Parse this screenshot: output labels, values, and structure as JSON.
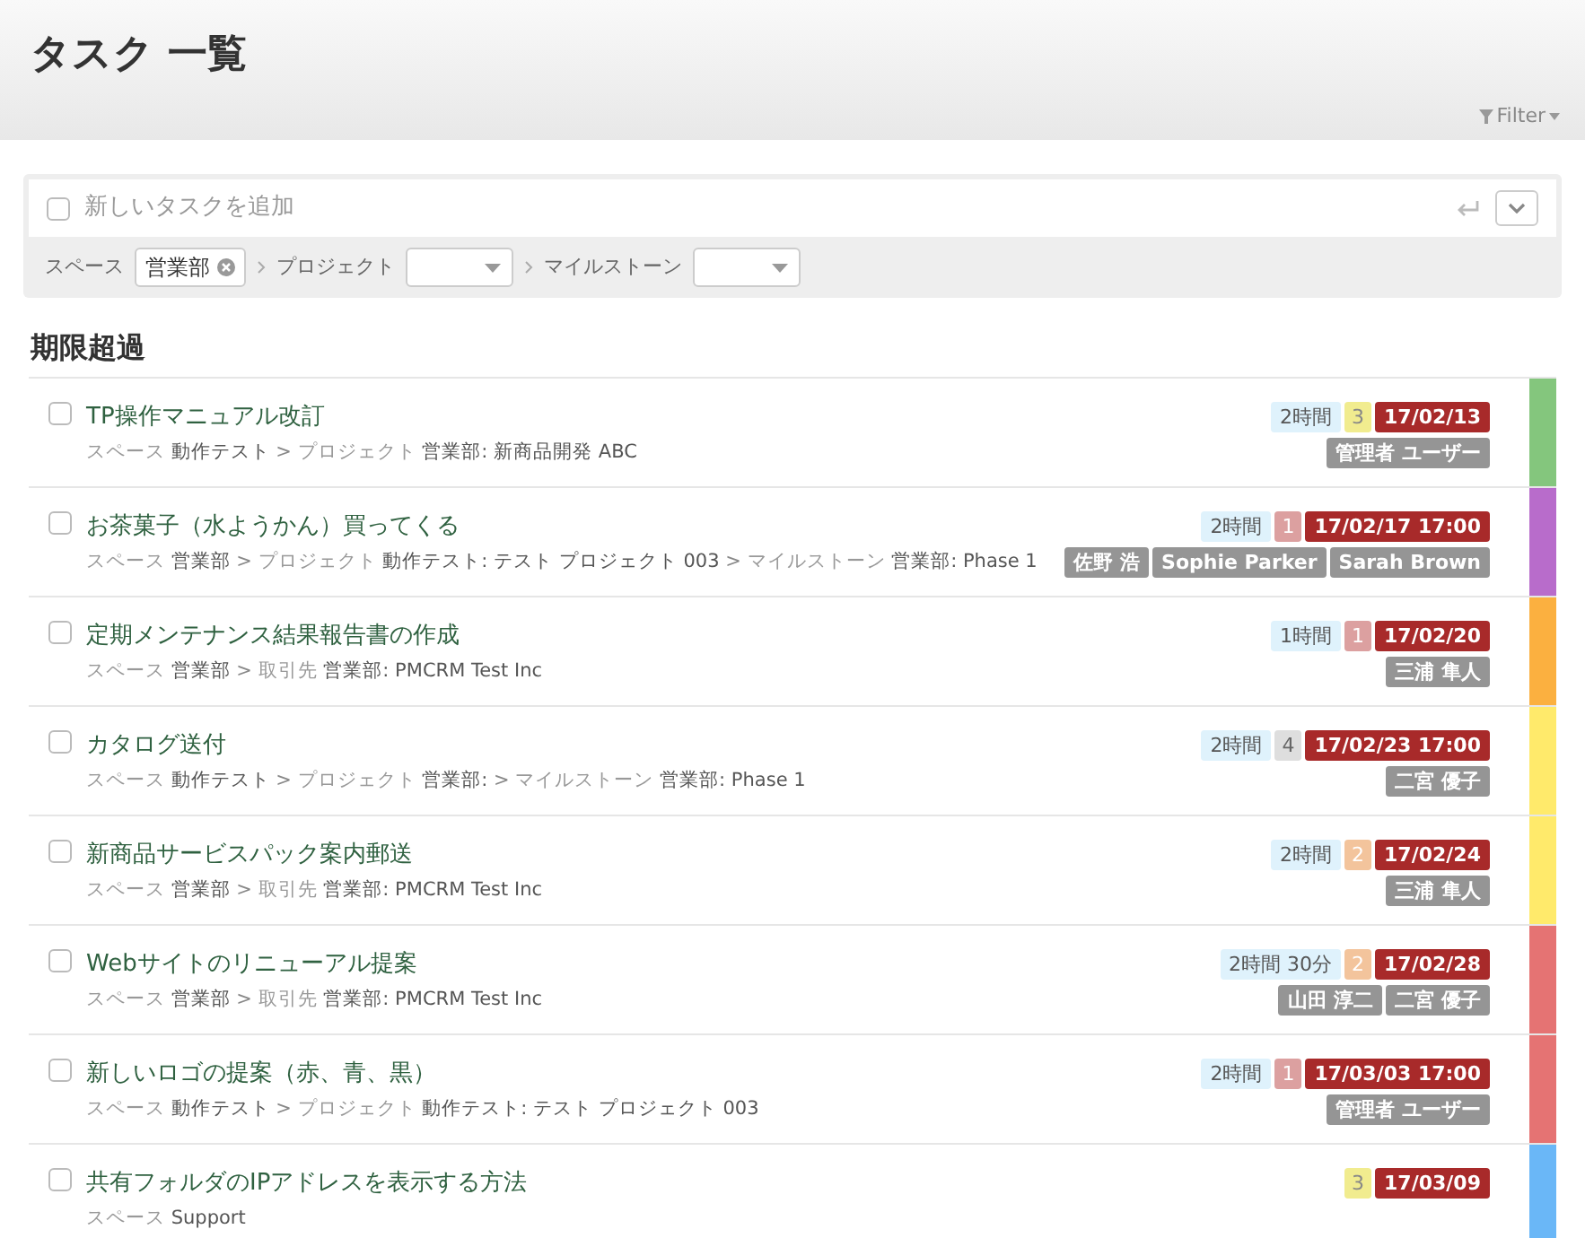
{
  "page": {
    "title": "タスク 一覧",
    "filter": "Filter"
  },
  "new_task": {
    "placeholder": "新しいタスクを追加",
    "checked": false,
    "space_label": "スペース",
    "space_value": "営業部",
    "project_label": "プロジェクト",
    "milestone_label": "マイルストーン"
  },
  "section": {
    "title": "期限超過"
  },
  "tasks": [
    {
      "title": "TP操作マニュアル改訂",
      "checked": false,
      "color": "#84c67d",
      "path": [
        {
          "label": "スペース",
          "value": "動作テスト"
        },
        {
          "separator": ">",
          "label": "プロジェクト",
          "value": "営業部: 新商品開発 ABC"
        }
      ],
      "estimate": "2時間",
      "priority": {
        "text": "3",
        "color": "#f1ec8f"
      },
      "due": "17/02/13",
      "assignees": [
        "管理者 ユーザー"
      ]
    },
    {
      "title": "お茶菓子（水ようかん）買ってくる",
      "checked": false,
      "color": "#b86ccb",
      "path": [
        {
          "label": "スペース",
          "value": "営業部"
        },
        {
          "separator": ">",
          "label": "プロジェクト",
          "value": "動作テスト: テスト プロジェクト 003"
        },
        {
          "separator": ">",
          "label": "マイルストーン",
          "value": "営業部: Phase 1"
        }
      ],
      "estimate": "2時間",
      "priority": {
        "text": "1",
        "color": "#dca0a0"
      },
      "due": "17/02/17 17:00",
      "assignees": [
        "佐野 浩",
        "Sophie Parker",
        "Sarah Brown"
      ]
    },
    {
      "title": "定期メンテナンス結果報告書の作成",
      "checked": false,
      "color": "#fbb040",
      "path": [
        {
          "label": "スペース",
          "value": "営業部"
        },
        {
          "separator": ">",
          "label": "取引先",
          "value": "営業部: PMCRM Test Inc"
        }
      ],
      "estimate": "1時間",
      "priority": {
        "text": "1",
        "color": "#dca0a0"
      },
      "due": "17/02/20",
      "assignees": [
        "三浦 隼人"
      ]
    },
    {
      "title": "カタログ送付",
      "checked": false,
      "color": "#ffea6b",
      "path": [
        {
          "label": "スペース",
          "value": "動作テスト"
        },
        {
          "separator": ">",
          "label": "プロジェクト",
          "value": "営業部:"
        },
        {
          "separator": ">",
          "label": "マイルストーン",
          "value": "営業部: Phase 1"
        }
      ],
      "estimate": "2時間",
      "priority": {
        "text": "4",
        "color": "#dedede"
      },
      "due": "17/02/23 17:00",
      "assignees": [
        "二宮 優子"
      ]
    },
    {
      "title": "新商品サービスパック案内郵送",
      "checked": false,
      "color": "#ffea6b",
      "path": [
        {
          "label": "スペース",
          "value": "営業部"
        },
        {
          "separator": ">",
          "label": "取引先",
          "value": "営業部: PMCRM Test Inc"
        }
      ],
      "estimate": "2時間",
      "priority": {
        "text": "2",
        "color": "#f3c49c"
      },
      "due": "17/02/24",
      "assignees": [
        "三浦 隼人"
      ]
    },
    {
      "title": "Webサイトのリニューアル提案",
      "checked": false,
      "color": "#e57373",
      "path": [
        {
          "label": "スペース",
          "value": "営業部"
        },
        {
          "separator": ">",
          "label": "取引先",
          "value": "営業部: PMCRM Test Inc"
        }
      ],
      "estimate": "2時間 30分",
      "priority": {
        "text": "2",
        "color": "#f3c49c"
      },
      "due": "17/02/28",
      "assignees": [
        "山田 淳二",
        "二宮 優子"
      ]
    },
    {
      "title": "新しいロゴの提案（赤、青、黒）",
      "checked": false,
      "color": "#e57373",
      "path": [
        {
          "label": "スペース",
          "value": "動作テスト"
        },
        {
          "separator": ">",
          "label": "プロジェクト",
          "value": "動作テスト: テスト プロジェクト 003"
        }
      ],
      "estimate": "2時間",
      "priority": {
        "text": "1",
        "color": "#dca0a0"
      },
      "due": "17/03/03 17:00",
      "assignees": [
        "管理者 ユーザー"
      ]
    },
    {
      "title": "共有フォルダのIPアドレスを表示する方法",
      "checked": false,
      "color": "#6ab7f7",
      "path": [
        {
          "label": "スペース",
          "value": "Support"
        }
      ],
      "priority": {
        "text": "3",
        "color": "#f1ec8f"
      },
      "due": "17/03/09"
    }
  ]
}
